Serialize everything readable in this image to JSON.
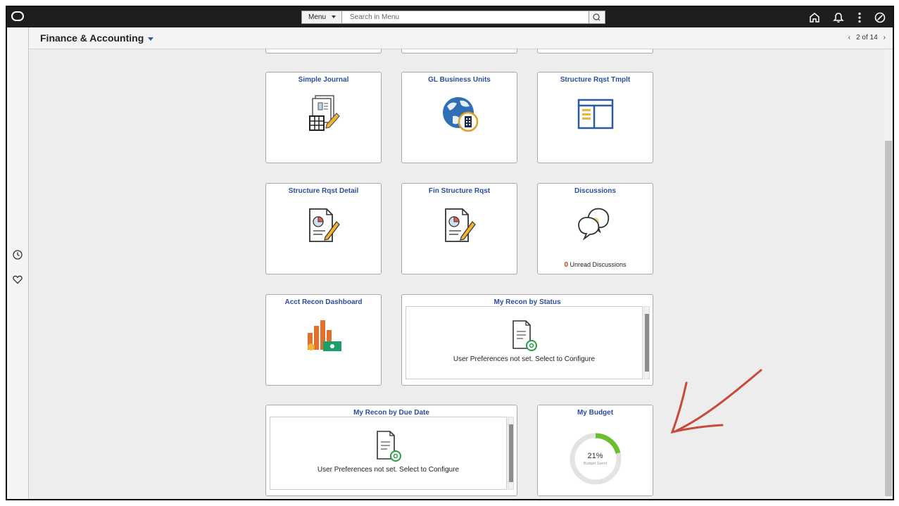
{
  "topbar": {
    "menu_label": "Menu",
    "search_placeholder": "Search in Menu",
    "icons": [
      "home-icon",
      "bell-icon",
      "kebab-icon",
      "compass-icon"
    ]
  },
  "header": {
    "title": "Finance & Accounting",
    "pager": "2 of 14"
  },
  "tiles": {
    "simple_journal": "Simple Journal",
    "gl_business_units": "GL Business Units",
    "structure_rqst_tmplt": "Structure Rqst Tmplt",
    "structure_rqst_detail": "Structure Rqst Detail",
    "fin_structure_rqst": "Fin Structure Rqst",
    "discussions": {
      "title": "Discussions",
      "count": "0",
      "text": "Unread Discussions"
    },
    "acct_recon_dashboard": "Acct Recon Dashboard",
    "my_recon_by_status": {
      "title": "My Recon by Status",
      "message": "User Preferences not set. Select to Configure"
    },
    "my_recon_by_due_date": {
      "title": "My Recon by Due Date",
      "message": "User Preferences not set. Select to Configure"
    },
    "my_budget": {
      "title": "My Budget",
      "percent": "21%",
      "label": "Budget Spent",
      "fraction": 0.21
    }
  },
  "colors": {
    "title_blue": "#2b4d9a",
    "annotation_red": "#c94a3a",
    "budget_green": "#6abf2c"
  }
}
